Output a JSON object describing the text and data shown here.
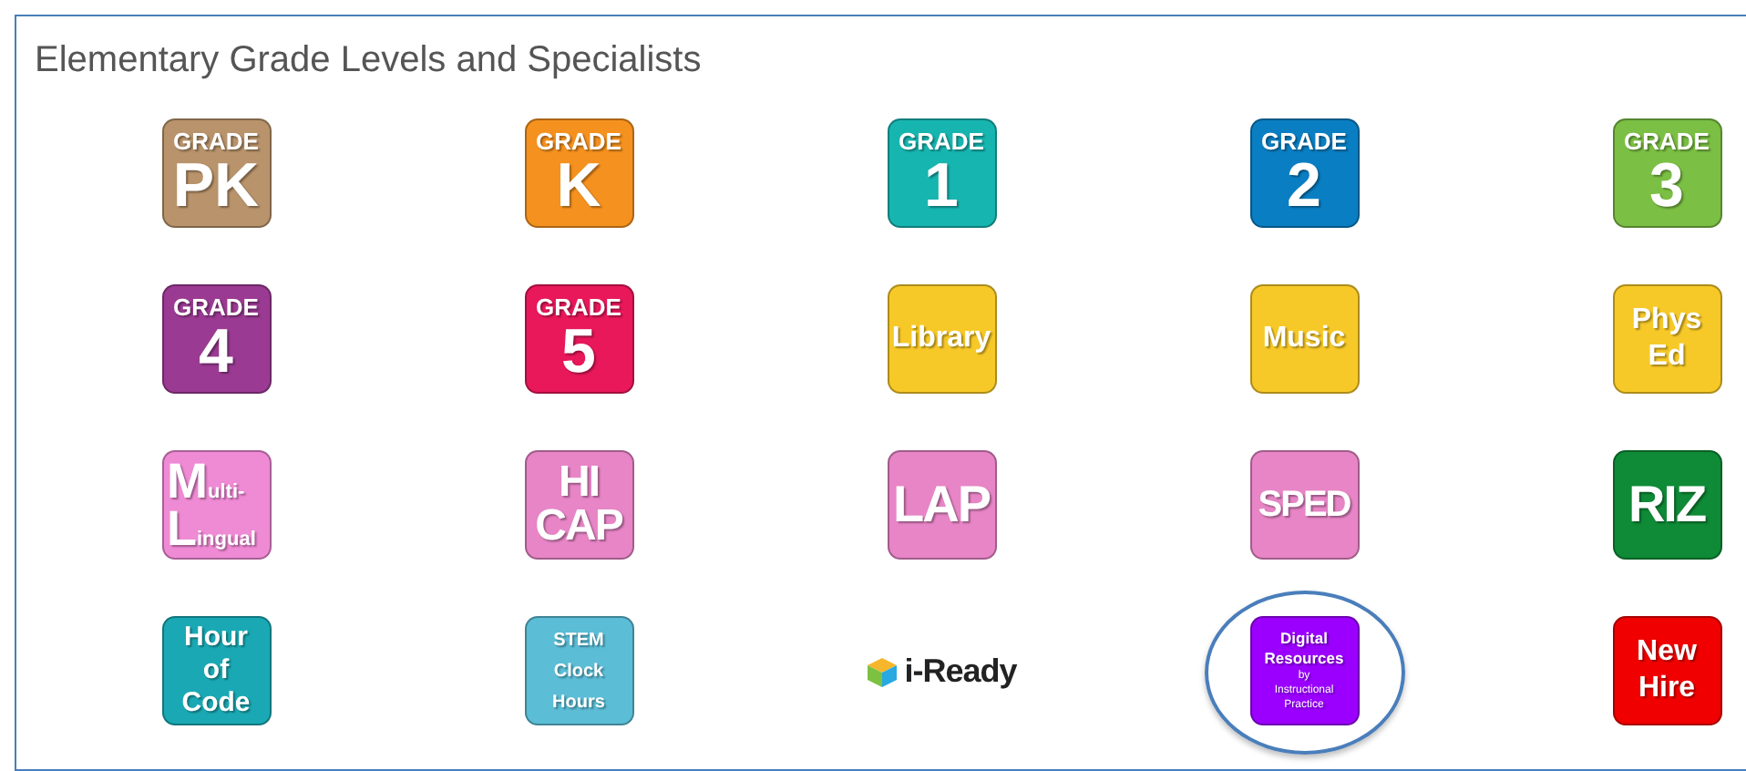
{
  "panel": {
    "title": "Elementary Grade Levels and Specialists"
  },
  "tiles": [
    {
      "kind": "grade",
      "color": "#b8936b",
      "top": "GRADE",
      "big": "PK"
    },
    {
      "kind": "grade",
      "color": "#f5911e",
      "top": "GRADE",
      "big": "K"
    },
    {
      "kind": "grade",
      "color": "#17b5b0",
      "top": "GRADE",
      "big": "1"
    },
    {
      "kind": "grade",
      "color": "#0a7ec2",
      "top": "GRADE",
      "big": "2"
    },
    {
      "kind": "grade",
      "color": "#7bbf44",
      "top": "GRADE",
      "big": "3"
    },
    {
      "kind": "grade",
      "color": "#9a3a92",
      "top": "GRADE",
      "big": "4"
    },
    {
      "kind": "grade",
      "color": "#e8185a",
      "top": "GRADE",
      "big": "5"
    },
    {
      "kind": "word",
      "color": "#f7c928",
      "lines": [
        "Library"
      ]
    },
    {
      "kind": "word",
      "color": "#f7c928",
      "lines": [
        "Music"
      ]
    },
    {
      "kind": "word",
      "color": "#f7c928",
      "lines": [
        "Phys",
        "Ed"
      ]
    },
    {
      "kind": "initials",
      "color": "#ef8ad4",
      "lines": [
        {
          "initial": "M",
          "rest": "ulti-"
        },
        {
          "initial": "L",
          "rest": "ingual"
        }
      ]
    },
    {
      "kind": "bigword",
      "color": "#e785c6",
      "lines": [
        "HI",
        "CAP"
      ]
    },
    {
      "kind": "bigword",
      "color": "#e785c6",
      "lines": [
        "LAP"
      ]
    },
    {
      "kind": "bigword",
      "color": "#e785c6",
      "lines": [
        "SPED"
      ]
    },
    {
      "kind": "bigword",
      "color": "#0f8a36",
      "lines": [
        "RIZ"
      ]
    },
    {
      "kind": "word",
      "color": "#1aa9b4",
      "lines": [
        "Hour",
        "of",
        "Code"
      ]
    },
    {
      "kind": "small",
      "color": "#5bbdd6",
      "lines": [
        "STEM",
        "Clock",
        "Hours"
      ]
    },
    {
      "kind": "logo",
      "text": "i-Ready"
    },
    {
      "kind": "caption",
      "color": "#9b00ff",
      "lines": [
        "Digital",
        "Resources"
      ],
      "fine": [
        "by",
        "Instructional",
        "Practice"
      ],
      "highlighted": true
    },
    {
      "kind": "word",
      "color": "#f00000",
      "lines": [
        "New",
        "Hire"
      ]
    }
  ]
}
